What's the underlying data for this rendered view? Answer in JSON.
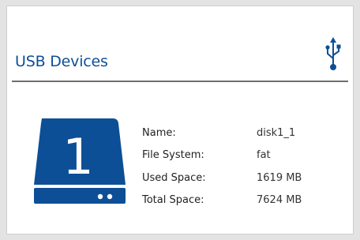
{
  "panel": {
    "title": "USB Devices",
    "header_icon": "usb-icon",
    "accent_color": "#0d4f96"
  },
  "device": {
    "icon": "drive-icon",
    "number": "1",
    "fields": [
      {
        "label": "Name:",
        "value": "disk1_1"
      },
      {
        "label": "File System:",
        "value": "fat"
      },
      {
        "label": "Used Space:",
        "value": "1619 MB"
      },
      {
        "label": "Total Space:",
        "value": "7624 MB"
      }
    ]
  }
}
